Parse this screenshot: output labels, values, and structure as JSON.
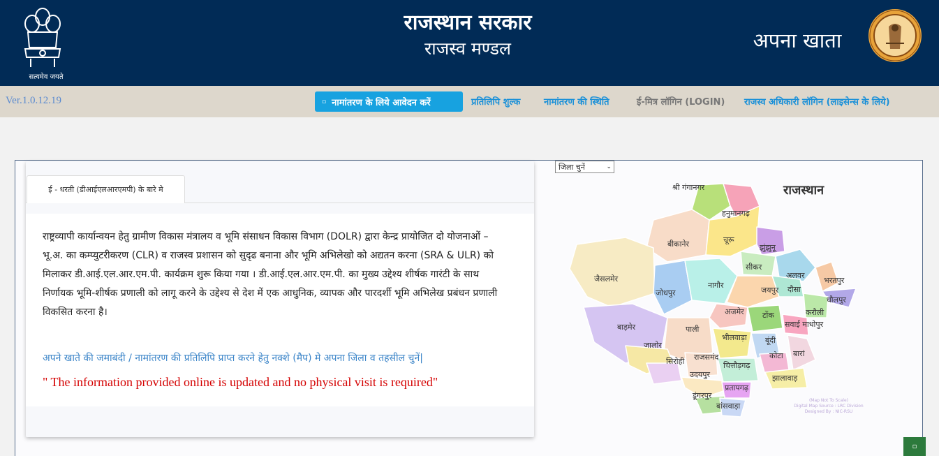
{
  "header": {
    "emblem_caption": "सत्यमेव जयते",
    "title": "राजस्थान सरकार",
    "subtitle": "राजस्व मण्डल",
    "app_name": "अपना खाता"
  },
  "nav": {
    "version": "Ver.1.0.12.19",
    "primary_button": "नामांतरण के लिये आवेदन करें",
    "links": [
      "प्रतिलिपि शुल्क",
      "नामांतरण की स्थिति",
      "ई-मित्र लॉगिन (LOGIN)",
      "राजस्व अधिकारी लॉगिन (लाइसेन्स के लिये)"
    ]
  },
  "card": {
    "tab_label": "ई - धरती (डीआईएलआरएमपी) के बारे मे",
    "description": "राष्ट्रव्यापी कार्यान्वयन हेतु ग्रामीण विकास मंत्रालय व भूमि संसाधन विकास विभाग (DOLR) द्वारा केन्द्र प्रायोजित दो योजनाओं – भू.अ. का कम्प्युटरीकरण (CLR) व राजस्व प्रशासन को सुदृढ बनाना और भूमि अभिलेखो को अद्यतन करना (SRA & ULR) को मिलाकर डी.आई.एल.आर.एम.पी. कार्यक्रम शुरू किया गया । डी.आई.एल.आर.एम.पी. का मुख्य उद्देश्य शीर्षक गारंटी के साथ निर्णायक भूमि-शीर्षक प्रणाली को लागू करने के उद्देश्य से देश में एक आधुनिक, व्यापक और पारदर्शी भूमि अभिलेख प्रबंधन प्रणाली विकसित करना है।",
    "instruction": "अपने खाते की जमाबंदी / नामांतरण की प्रतिलिपि प्राप्त करने हेतु नक्शे (मैप) मे अपना जिला व तहसील चुनें|",
    "notice": "\" The information provided online is updated and no physical visit is required\""
  },
  "map": {
    "select_value": "जिला चुनें",
    "state_title": "राजस्थान",
    "districts": [
      "श्री गंगानगर",
      "हनुमानगढ़",
      "बीकानेर",
      "चूरू",
      "झुंझुनू",
      "सीकर",
      "अलवर",
      "भरतपुर",
      "जैसलमेर",
      "जोधपुर",
      "नागौर",
      "जयपुर",
      "दौसा",
      "धौलपुर",
      "करौली",
      "अजमेर",
      "टोंक",
      "सवाई माधोपुर",
      "बाड़मेर",
      "पाली",
      "भीलवाड़ा",
      "बूंदी",
      "जालोर",
      "सिरोही",
      "राजसमंद",
      "चित्तौड़गढ़",
      "कोटा",
      "बारां",
      "उदयपुर",
      "झालावाड़",
      "प्रतापगढ़",
      "डूंगरपुर",
      "बांसवाड़ा"
    ],
    "note_lines": [
      "(Map Not To Scale)",
      "Digital Map Source : LRC Division",
      "Designed By : NIC-RSU"
    ]
  },
  "colors": {
    "header_bg": "#012b56",
    "nav_bg": "#ddd7cc",
    "primary_button": "#17a2e0",
    "link": "#1a90d8",
    "notice": "#d40000"
  }
}
